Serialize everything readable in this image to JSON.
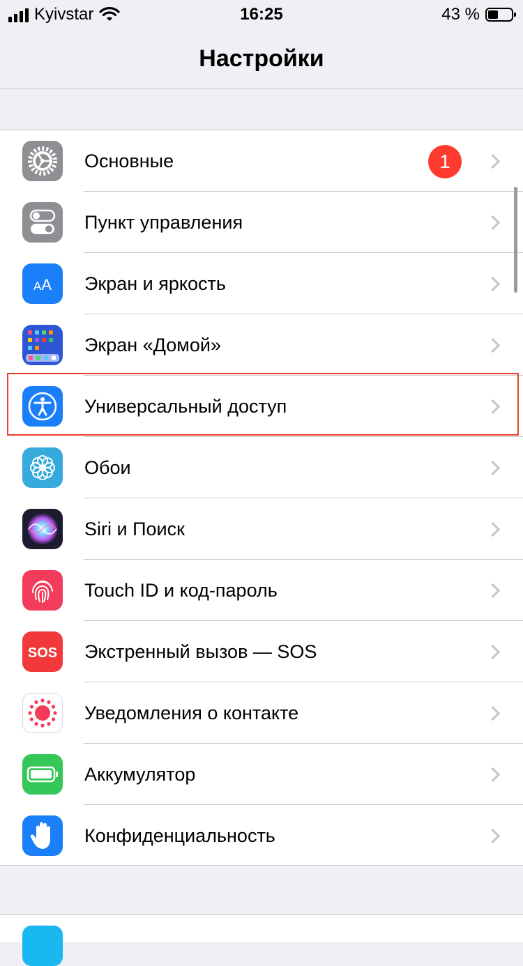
{
  "status_bar": {
    "carrier": "Kyivstar",
    "time": "16:25",
    "battery_percent": "43 %",
    "battery_level": 0.43
  },
  "nav": {
    "title": "Настройки"
  },
  "settings": {
    "items": [
      {
        "label": "Основные",
        "icon": "gear-icon",
        "color": "#8e8e93",
        "badge": "1"
      },
      {
        "label": "Пункт управления",
        "icon": "control-center-icon",
        "color": "#8e8e93"
      },
      {
        "label": "Экран и яркость",
        "icon": "display-brightness-icon",
        "color": "#1a7ff8"
      },
      {
        "label": "Экран «Домой»",
        "icon": "home-screen-icon",
        "color": "#2d55d4"
      },
      {
        "label": "Универсальный доступ",
        "icon": "accessibility-icon",
        "color": "#1a7ff8",
        "highlighted": true
      },
      {
        "label": "Обои",
        "icon": "wallpaper-flower-icon",
        "color": "#36aadc"
      },
      {
        "label": "Siri и Поиск",
        "icon": "siri-icon",
        "color": "#1c1c2e"
      },
      {
        "label": "Touch ID и код-пароль",
        "icon": "fingerprint-icon",
        "color": "#f33c5b"
      },
      {
        "label": "Экстренный вызов — SOS",
        "icon": "sos-icon",
        "color": "#f2383a"
      },
      {
        "label": "Уведомления о контакте",
        "icon": "exposure-notification-icon",
        "color": "#ffffff"
      },
      {
        "label": "Аккумулятор",
        "icon": "battery-icon",
        "color": "#36c759"
      },
      {
        "label": "Конфиденциальность",
        "icon": "privacy-hand-icon",
        "color": "#1a7ff8"
      }
    ]
  },
  "colors": {
    "background": "#efeff4",
    "badge": "#ff3b30",
    "highlight_frame": "#e8412c"
  }
}
